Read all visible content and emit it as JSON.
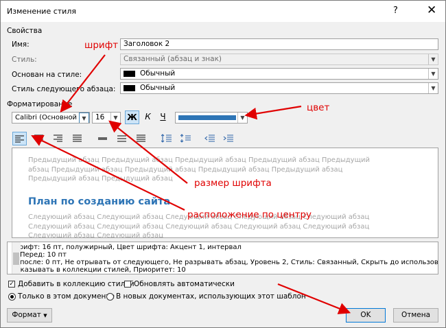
{
  "window": {
    "title": "Изменение стиля",
    "help_glyph": "?",
    "close_glyph": "✕"
  },
  "properties": {
    "header": "Свойства",
    "name_label": "Имя:",
    "name_value": "Заголовок 2",
    "style_label": "Стиль:",
    "style_value": "Связанный (абзац и знак)",
    "based_on_label": "Основан на стиле:",
    "based_on_value": "Обычный",
    "next_label": "Стиль следующего абзаца:",
    "next_value": "Обычный"
  },
  "formatting": {
    "header": "Форматирование",
    "font_value": "Calibri (Основной те",
    "size_value": "16",
    "bold_label": "Ж",
    "italic_label": "К",
    "underline_label": "Ч",
    "color_value": "#2e75b6"
  },
  "preview": {
    "prev_text": "Предыдущий абзац Предыдущий абзац Предыдущий абзац Предыдущий абзац Предыдущий абзац Предыдущий абзац Предыдущий абзац Предыдущий абзац Предыдущий абзац Предыдущий абзац Предыдущий абзац",
    "heading": "План по созданию сайта",
    "next_text": "Следующий абзац Следующий абзац Следующий абзац Следующий абзац Следующий абзац Следующий абзац Следующий абзац Следующий абзац Следующий абзац Следующий абзац Следующий абзац Следующий абзац"
  },
  "description": {
    "line1": "Шрифт: 16 пт, полужирный, Цвет шрифта: Акцент 1, интервал",
    "line2": "Перед:  10 пт",
    "line3": "после: 0 пт, Не отрывать от следующего, Не разрывать абзац, Уровень 2, Стиль: Связанный, Скрыть до использования, :",
    "line4": "показывать в коллекции стилей, Приоритет: 10"
  },
  "options": {
    "add_to_gallery": "Добавить в коллекцию стилей",
    "auto_update": "Обновлять автоматически",
    "only_this_doc": "Только в этом документе",
    "new_docs": "В новых документах, использующих этот шаблон"
  },
  "buttons": {
    "format": "Формат",
    "ok": "OK",
    "cancel": "Отмена"
  },
  "annotations": {
    "font": "шрифт",
    "color": "цвет",
    "font_size": "размер шрифта",
    "alignment": "расположение по центру"
  },
  "colors": {
    "annotation": "#e00000",
    "heading": "#2e75b6",
    "accent": "#6aa7d8"
  }
}
